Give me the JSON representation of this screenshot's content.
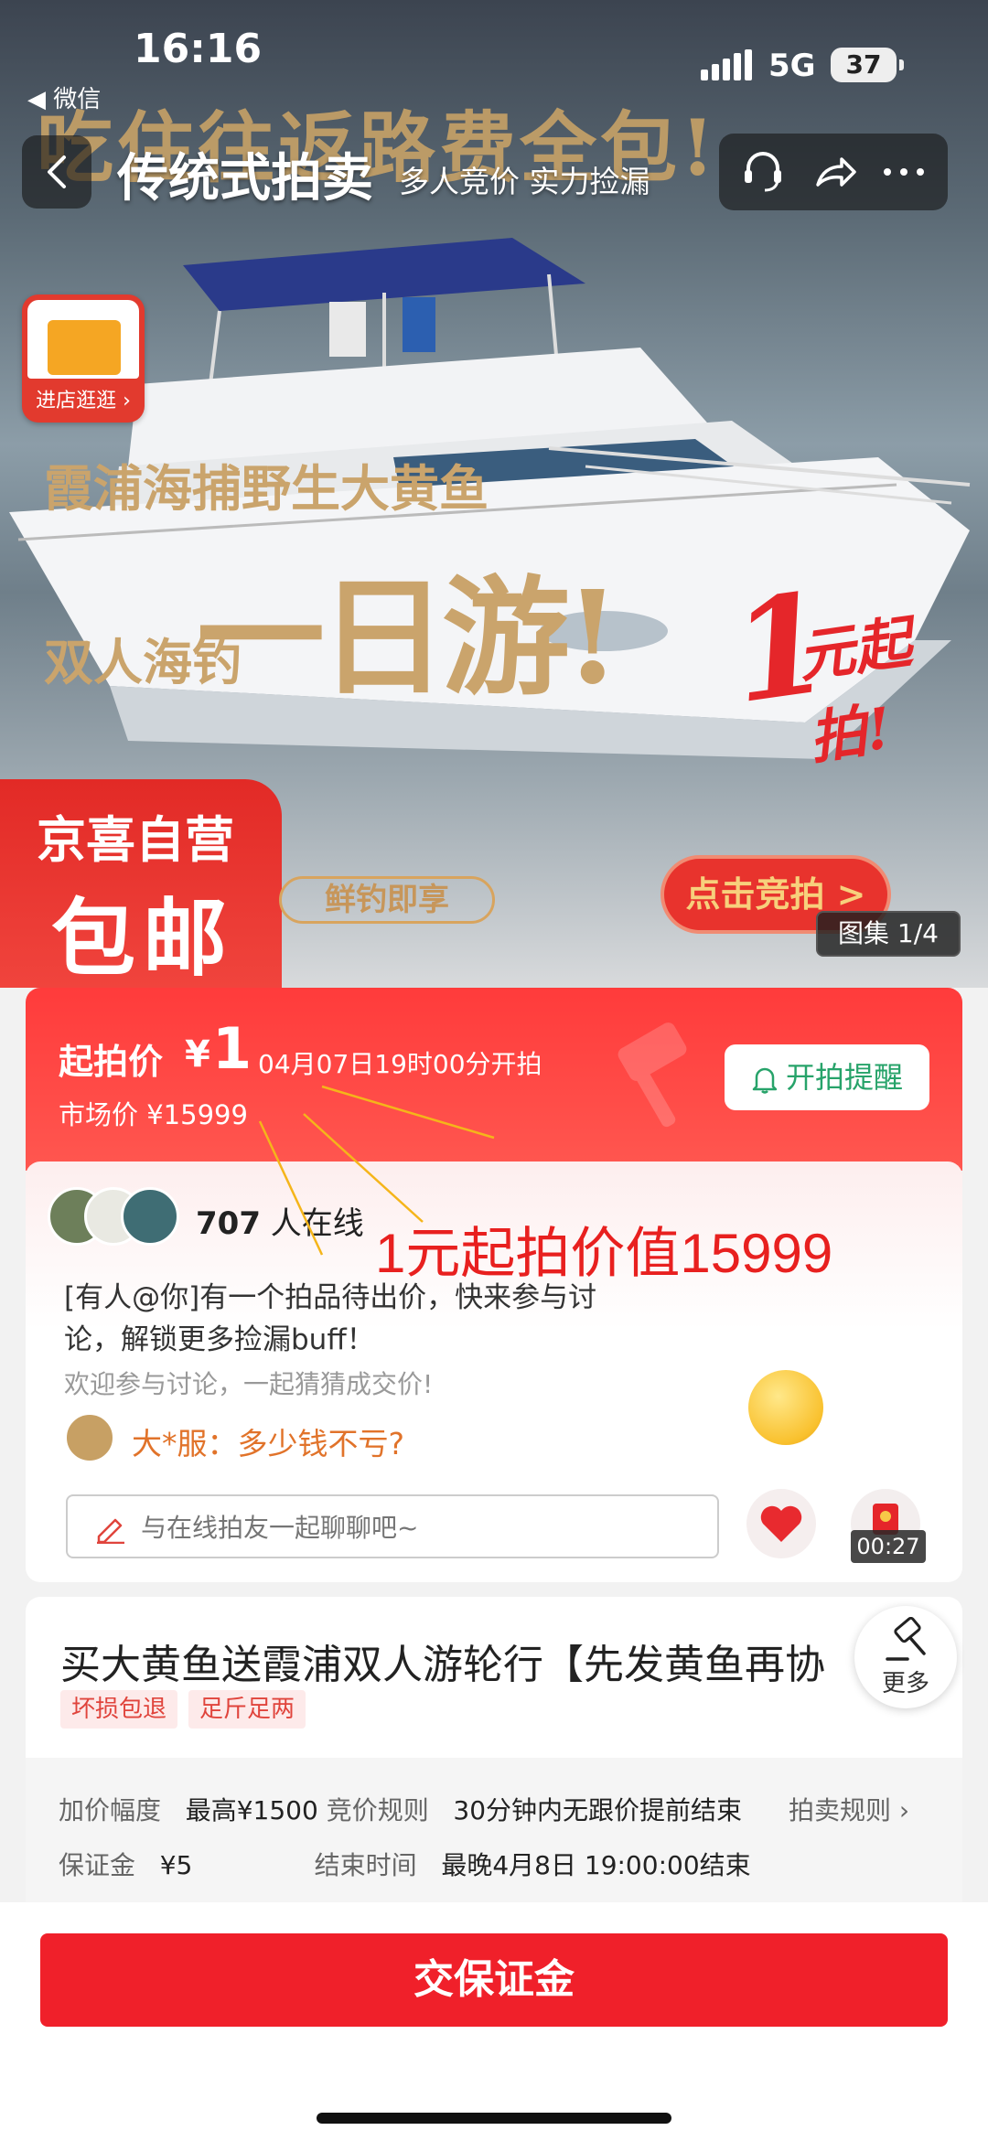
{
  "status_bar": {
    "time": "16:16",
    "back_app": "◀ 微信",
    "network": "5G",
    "battery": "37"
  },
  "nav": {
    "title": "传统式拍卖",
    "subtitle": "多人竞价 实力捡漏"
  },
  "hero": {
    "banner_top": "吃住往返路费全包!",
    "line1": "霞浦海捕野生大黄鱼",
    "line2a": "双人海钓",
    "line2b": "一日游!",
    "badge_big": "1",
    "badge_small": "元起拍!",
    "shop_badge_label": "进店逛逛 ›",
    "self_op_line1": "京喜自营",
    "self_op_line2": "包邮",
    "pill_fresh": "鲜钓即享",
    "pill_bid": "点击竞拍 >",
    "gallery_count": "图集 1/4"
  },
  "price_card": {
    "label": "起拍价",
    "currency": "¥",
    "price": "1",
    "start_time": "04月07日19时00分开拍",
    "market_price": "市场价 ¥15999",
    "remind_label": "开拍提醒"
  },
  "annotation_text": "1元起拍价值15999",
  "chat": {
    "online_count": "707",
    "online_suffix": "人在线",
    "message": "[有人@你]有一个拍品待出价，快来参与讨论，解锁更多捡漏buff！",
    "welcome": "欢迎参与讨论，一起猜猜成交价!",
    "reply": "大*服：多少钱不亏?",
    "input_placeholder": "与在线拍友一起聊聊吧~",
    "gift_timer": "00:27"
  },
  "product": {
    "title": "买大黄鱼送霞浦双人游轮行【先发黄鱼再协",
    "tags": [
      "坏损包退",
      "足斤足两"
    ],
    "more_label": "更多"
  },
  "rules": {
    "increment_label": "加价幅度",
    "increment_value": "最高¥1500",
    "bid_rule_label": "竞价规则",
    "bid_rule_value": "30分钟内无跟价提前结束",
    "rules_link": "拍卖规则",
    "deposit_label": "保证金",
    "deposit_value": "¥5",
    "end_label": "结束时间",
    "end_value": "最晚4月8日 19:00:00结束"
  },
  "bottom": {
    "deposit_button": "交保证金"
  },
  "colors": {
    "primary_red": "#f0202a",
    "accent_green": "#27a36a",
    "annotation_red": "#e8201f",
    "gold": "#caa46c"
  }
}
